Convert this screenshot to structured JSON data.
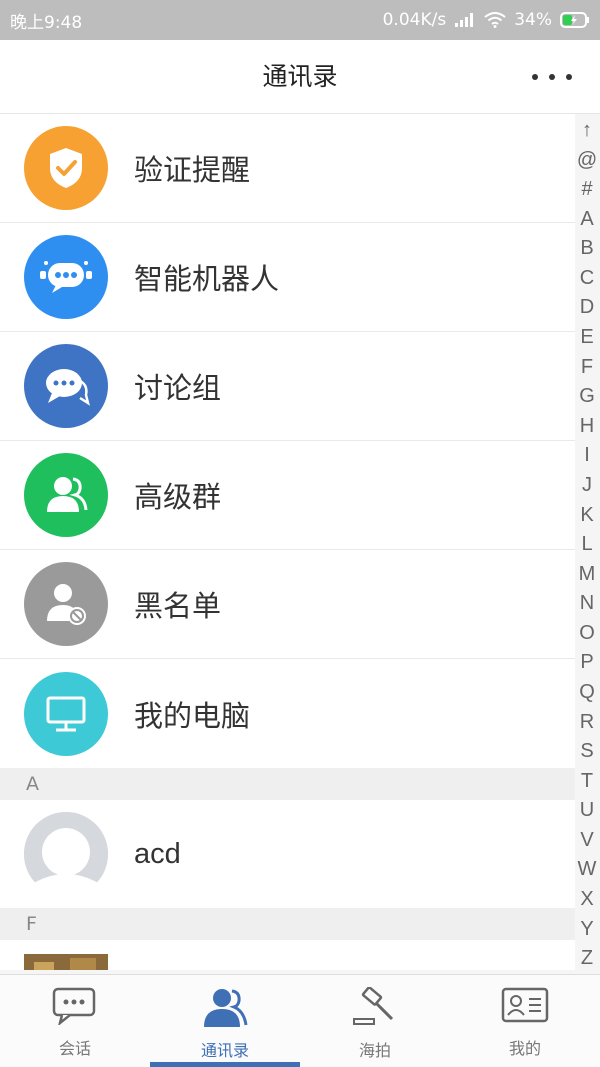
{
  "status_bar": {
    "time": "晚上9:48",
    "network_speed": "0.04K/s",
    "battery": "34%"
  },
  "header": {
    "title": "通讯录",
    "more_icon": "more-dots-icon"
  },
  "menu_items": [
    {
      "label": "验证提醒",
      "icon": "shield-check-icon",
      "color": "#f6a131"
    },
    {
      "label": "智能机器人",
      "icon": "robot-icon",
      "color": "#2f8ff0"
    },
    {
      "label": "讨论组",
      "icon": "chat-bubbles-icon",
      "color": "#3f74c4"
    },
    {
      "label": "高级群",
      "icon": "group-icon",
      "color": "#1fbf5e"
    },
    {
      "label": "黑名单",
      "icon": "blocked-user-icon",
      "color": "#9a9a9a"
    },
    {
      "label": "我的电脑",
      "icon": "computer-icon",
      "color": "#3ec9d6"
    }
  ],
  "sections": [
    {
      "letter": "A",
      "contacts": [
        {
          "name": "acd"
        }
      ]
    },
    {
      "letter": "F",
      "contacts": [
        {
          "name": ""
        }
      ]
    }
  ],
  "index_letters": [
    "↑",
    "@",
    "#",
    "A",
    "B",
    "C",
    "D",
    "E",
    "F",
    "G",
    "H",
    "I",
    "J",
    "K",
    "L",
    "M",
    "N",
    "O",
    "P",
    "Q",
    "R",
    "S",
    "T",
    "U",
    "V",
    "W",
    "X",
    "Y",
    "Z"
  ],
  "bottom_nav": [
    {
      "label": "会话",
      "icon": "chat-icon",
      "active": false
    },
    {
      "label": "通讯录",
      "icon": "contacts-icon",
      "active": true
    },
    {
      "label": "海拍",
      "icon": "auction-hammer-icon",
      "active": false
    },
    {
      "label": "我的",
      "icon": "profile-card-icon",
      "active": false
    }
  ],
  "colors": {
    "accent": "#3f6fb5"
  }
}
